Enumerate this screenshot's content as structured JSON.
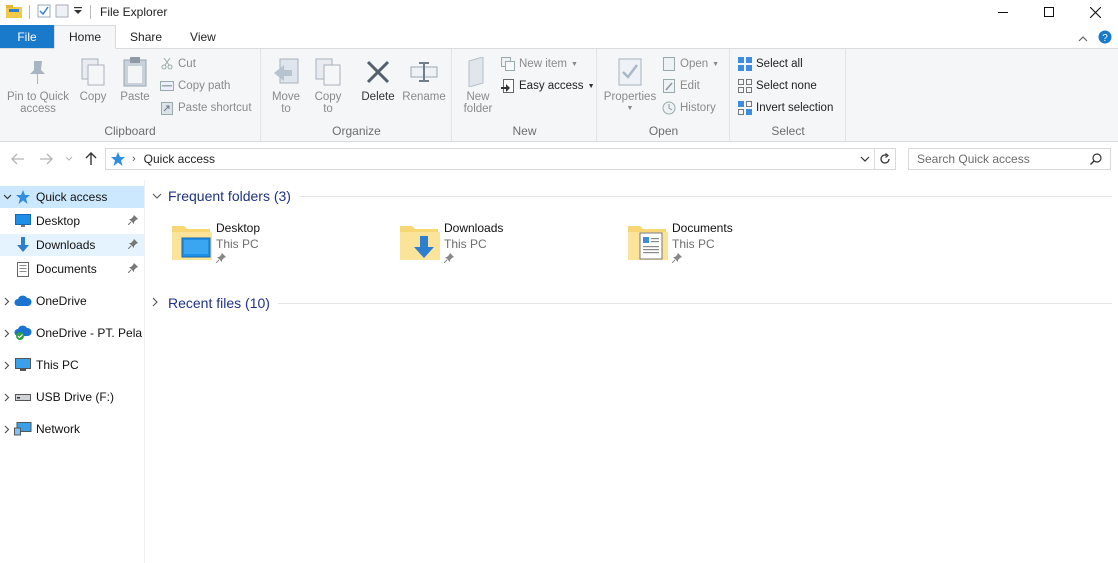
{
  "window": {
    "title": "File Explorer",
    "controls": [
      "minimize",
      "maximize",
      "close"
    ]
  },
  "ribbon": {
    "tabs": [
      {
        "label": "File"
      },
      {
        "label": "Home"
      },
      {
        "label": "Share"
      },
      {
        "label": "View"
      }
    ],
    "groups": {
      "clipboard": {
        "label": "Clipboard",
        "pin": "Pin to Quick access",
        "copy": "Copy",
        "paste": "Paste",
        "cut": "Cut",
        "copy_path": "Copy path",
        "paste_shortcut": "Paste shortcut"
      },
      "organize": {
        "label": "Organize",
        "move_to": "Move to",
        "copy_to": "Copy to",
        "delete": "Delete",
        "rename": "Rename"
      },
      "new": {
        "label": "New",
        "new_folder": "New folder",
        "new_item": "New item",
        "easy_access": "Easy access"
      },
      "open": {
        "label": "Open",
        "properties": "Properties",
        "open": "Open",
        "edit": "Edit",
        "history": "History"
      },
      "select": {
        "label": "Select",
        "select_all": "Select all",
        "select_none": "Select none",
        "invert_selection": "Invert selection"
      }
    }
  },
  "address": {
    "path": "Quick access",
    "search_placeholder": "Search Quick access"
  },
  "nav": {
    "quick_access": "Quick access",
    "pinned": [
      {
        "label": "Desktop"
      },
      {
        "label": "Downloads"
      },
      {
        "label": "Documents"
      }
    ],
    "roots": [
      {
        "label": "OneDrive"
      },
      {
        "label": "OneDrive - PT. Pela"
      },
      {
        "label": "This PC"
      },
      {
        "label": "USB Drive (F:)"
      },
      {
        "label": "Network"
      }
    ]
  },
  "content": {
    "frequent_header": "Frequent folders (3)",
    "recent_header": "Recent files (10)",
    "folders": [
      {
        "name": "Desktop",
        "location": "This PC"
      },
      {
        "name": "Downloads",
        "location": "This PC"
      },
      {
        "name": "Documents",
        "location": "This PC"
      }
    ]
  },
  "colors": {
    "accent": "#1979ca",
    "nav_selected": "#cce8ff",
    "nav_hover": "#e5f3ff",
    "section_header": "#1e3287",
    "folder": "#f7d775"
  }
}
